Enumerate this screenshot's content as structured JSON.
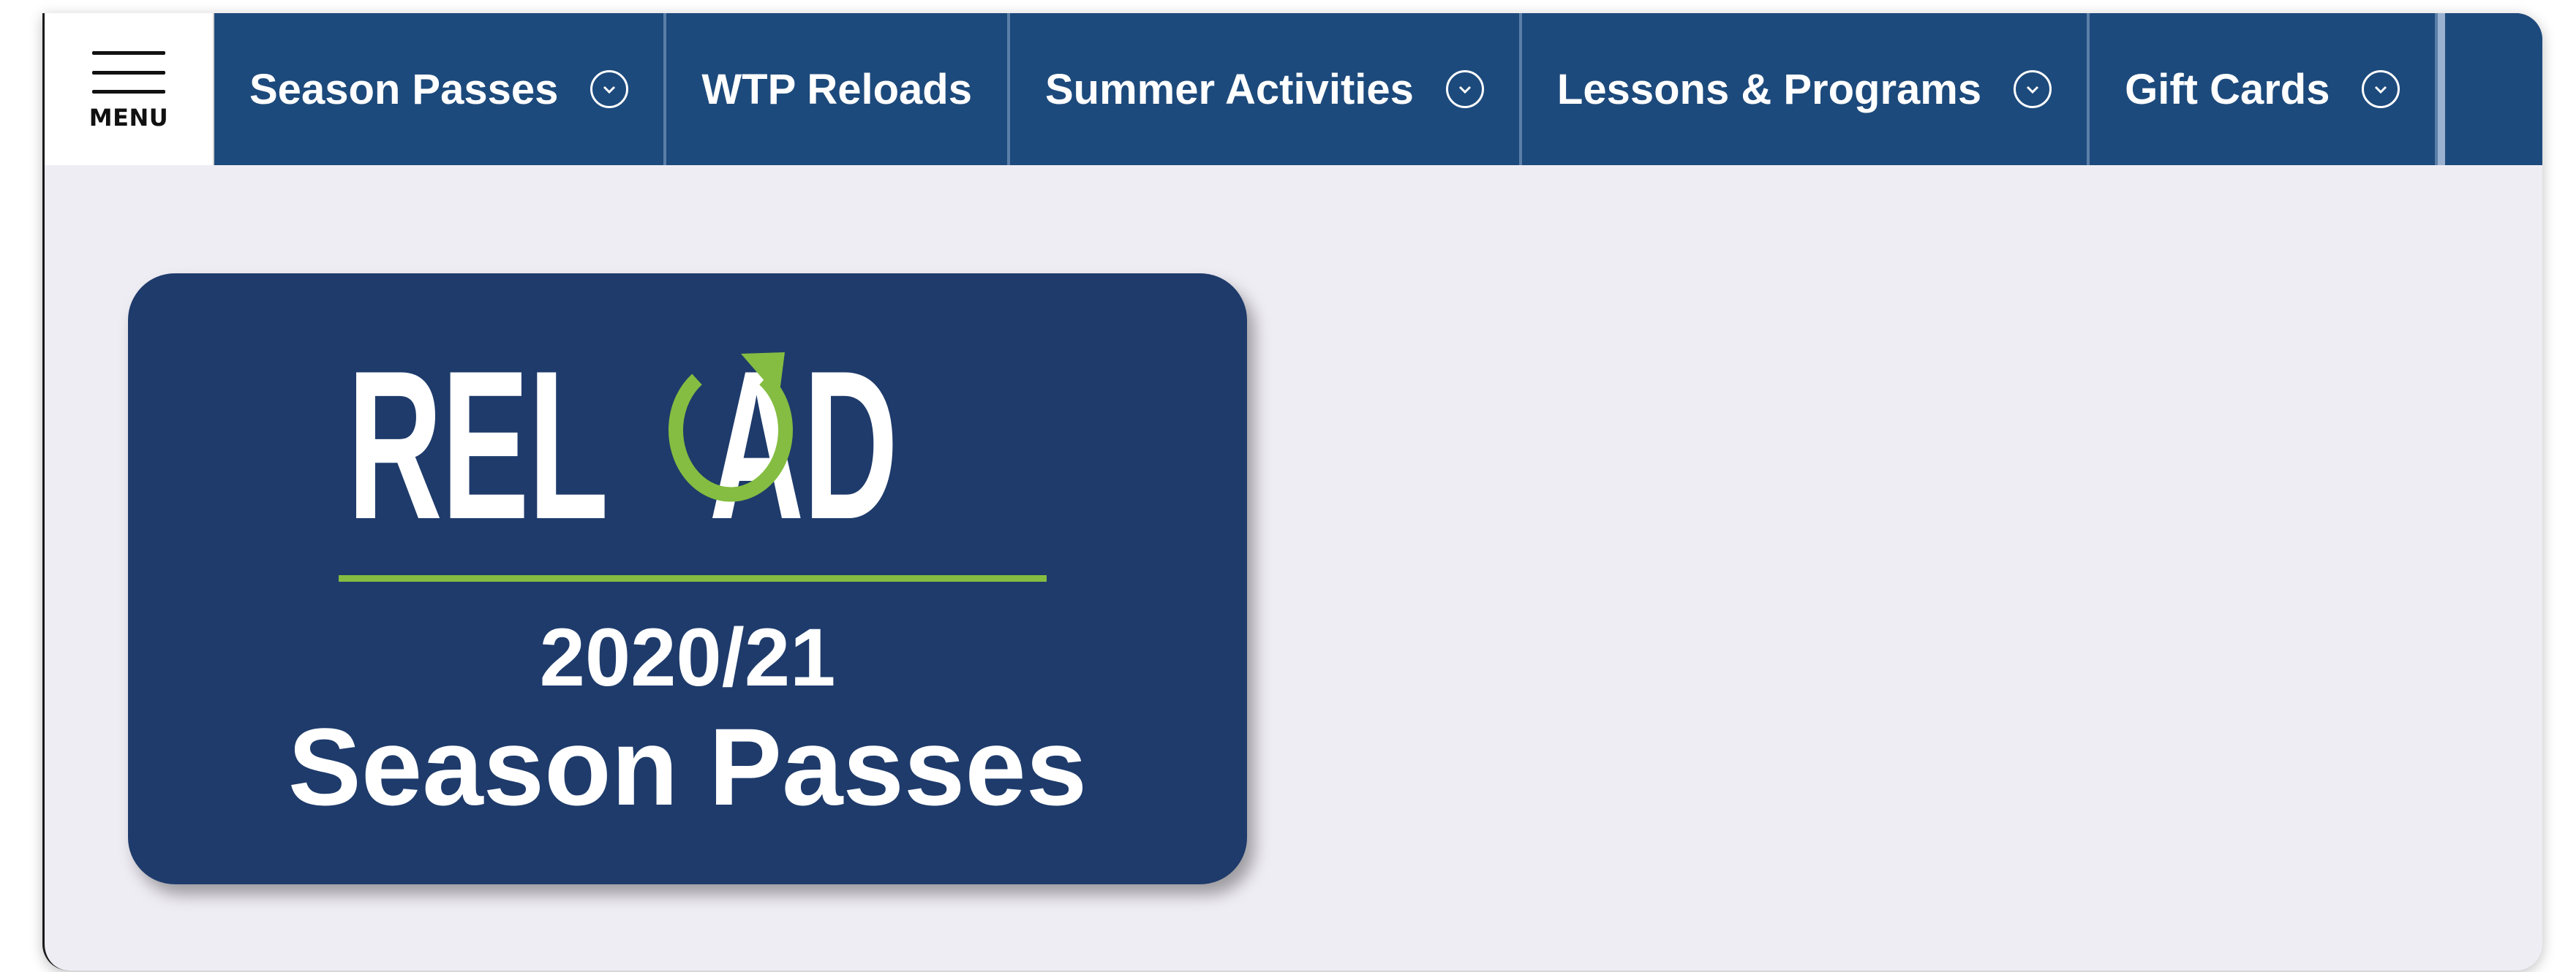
{
  "nav": {
    "menu_label": "MENU",
    "items": [
      {
        "label": "Season Passes",
        "has_dropdown": true,
        "icon": "chevron-circle-down-icon"
      },
      {
        "label": "WTP Reloads",
        "has_dropdown": false
      },
      {
        "label": "Summer Activities",
        "has_dropdown": true,
        "icon": "chevron-circle-down-icon"
      },
      {
        "label": "Lessons & Programs",
        "has_dropdown": true,
        "icon": "chevron-circle-down-icon"
      },
      {
        "label": "Gift Cards",
        "has_dropdown": true,
        "icon": "chevron-circle-down-icon"
      }
    ]
  },
  "promo": {
    "logo_text": "RELOAD",
    "year": "2020/21",
    "title": "Season Passes"
  },
  "colors": {
    "nav_bg": "#1d4a7c",
    "card_bg": "#1e3b6b",
    "accent_green": "#84bd41",
    "page_bg": "#efedf4"
  }
}
